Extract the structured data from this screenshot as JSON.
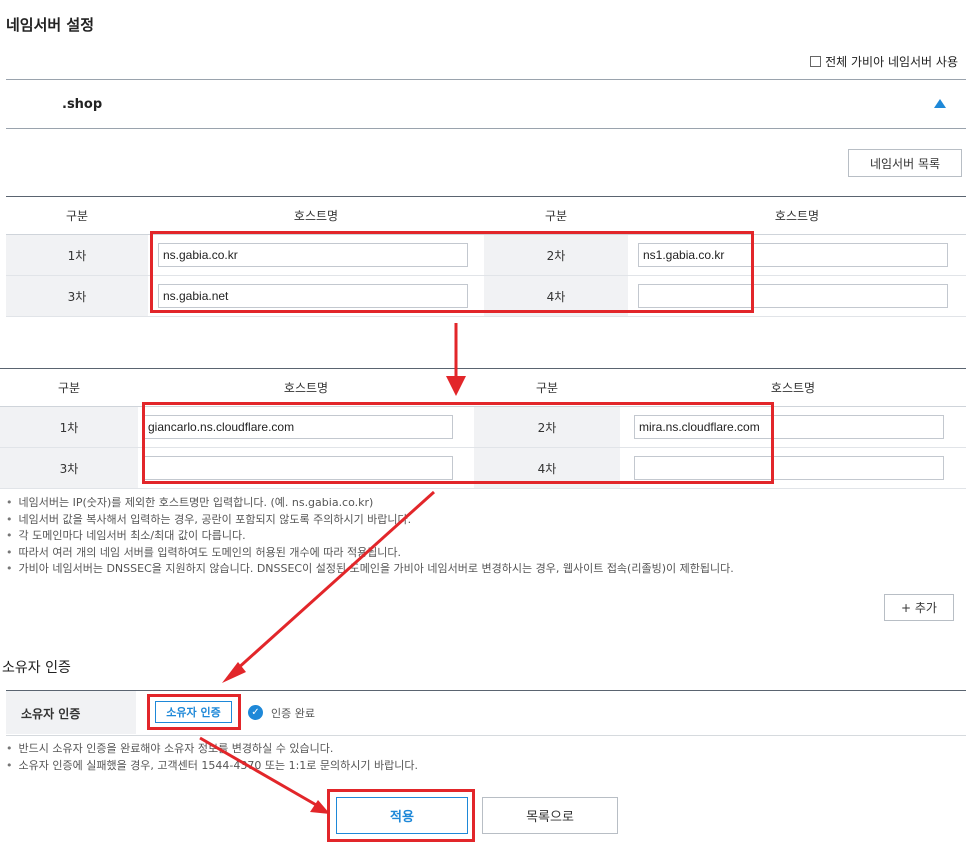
{
  "section_title": "네임서버 설정",
  "all_gabia_ns_label": "전체 가비아 네임서버 사용",
  "tld": ".shop",
  "ns_list_button": "네임서버 목록",
  "headers": {
    "col1": "구분",
    "col2": "호스트명",
    "col3": "구분",
    "col4": "호스트명"
  },
  "table1": {
    "rows": [
      {
        "label1": "1차",
        "value1": "ns.gabia.co.kr",
        "label2": "2차",
        "value2": "ns1.gabia.co.kr"
      },
      {
        "label1": "3차",
        "value1": "ns.gabia.net",
        "label2": "4차",
        "value2": ""
      }
    ]
  },
  "table2": {
    "rows": [
      {
        "label1": "1차",
        "value1": "giancarlo.ns.cloudflare.com",
        "label2": "2차",
        "value2": "mira.ns.cloudflare.com"
      },
      {
        "label1": "3차",
        "value1": "",
        "label2": "4차",
        "value2": ""
      }
    ]
  },
  "notes": [
    "네임서버는 IP(숫자)를 제외한 호스트명만 입력합니다. (예. ns.gabia.co.kr)",
    "네임서버 값을 복사해서 입력하는 경우, 공란이 포함되지 않도록 주의하시기 바랍니다.",
    "각 도메인마다 네임서버 최소/최대 값이 다릅니다.",
    "따라서 여러 개의 네임 서버를 입력하여도 도메인의 허용된 개수에 따라 적용됩니다.",
    "가비아 네임서버는 DNSSEC을 지원하지 않습니다. DNSSEC이 설정된 도메인을 가비아 네임서버로 변경하시는 경우, 웹사이트 접속(리졸빙)이 제한됩니다."
  ],
  "add_button": "+ 추가",
  "owner_section_title": "소유자 인증",
  "owner_label": "소유자 인증",
  "owner_button": "소유자 인증",
  "owner_status": "인증 완료",
  "owner_notes": [
    "반드시 소유자 인증을 완료해야 소유자 정보를 변경하실 수 있습니다.",
    "소유자 인증에 실패했을 경우, 고객센터 1544-4370 또는 1:1로 문의하시기 바랍니다."
  ],
  "apply_button": "적용",
  "list_button": "목록으로",
  "colors": {
    "accent": "#1e88d8",
    "annotation_red": "#e2262a"
  }
}
